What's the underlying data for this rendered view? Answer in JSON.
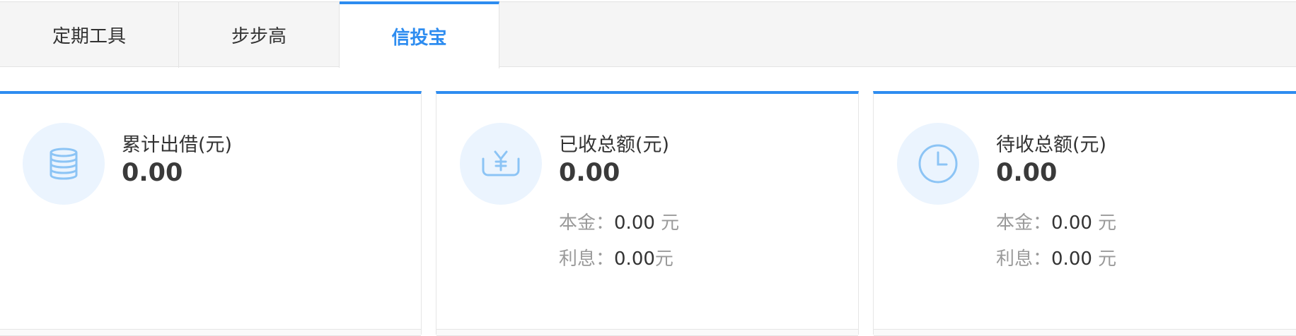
{
  "tabs": [
    {
      "label": "定期工具"
    },
    {
      "label": "步步高"
    },
    {
      "label": "信投宝"
    }
  ],
  "colors": {
    "accent": "#2d8cf0",
    "icon_bg": "#ebf4fe",
    "icon_stroke": "#8cc4f5"
  },
  "cards": [
    {
      "icon": "coins-stack-icon",
      "title": "累计出借(元)",
      "amount": "0.00"
    },
    {
      "icon": "yen-tray-icon",
      "title": "已收总额(元)",
      "amount": "0.00",
      "principal_label": "本金：",
      "principal_value": "0.00",
      "principal_unit": " 元",
      "interest_label": "利息：",
      "interest_value": "0.00",
      "interest_unit": "元"
    },
    {
      "icon": "clock-icon",
      "title": "待收总额(元)",
      "amount": "0.00",
      "principal_label": "本金：",
      "principal_value": "0.00",
      "principal_unit": " 元",
      "interest_label": "利息：",
      "interest_value": "0.00",
      "interest_unit": " 元"
    }
  ]
}
